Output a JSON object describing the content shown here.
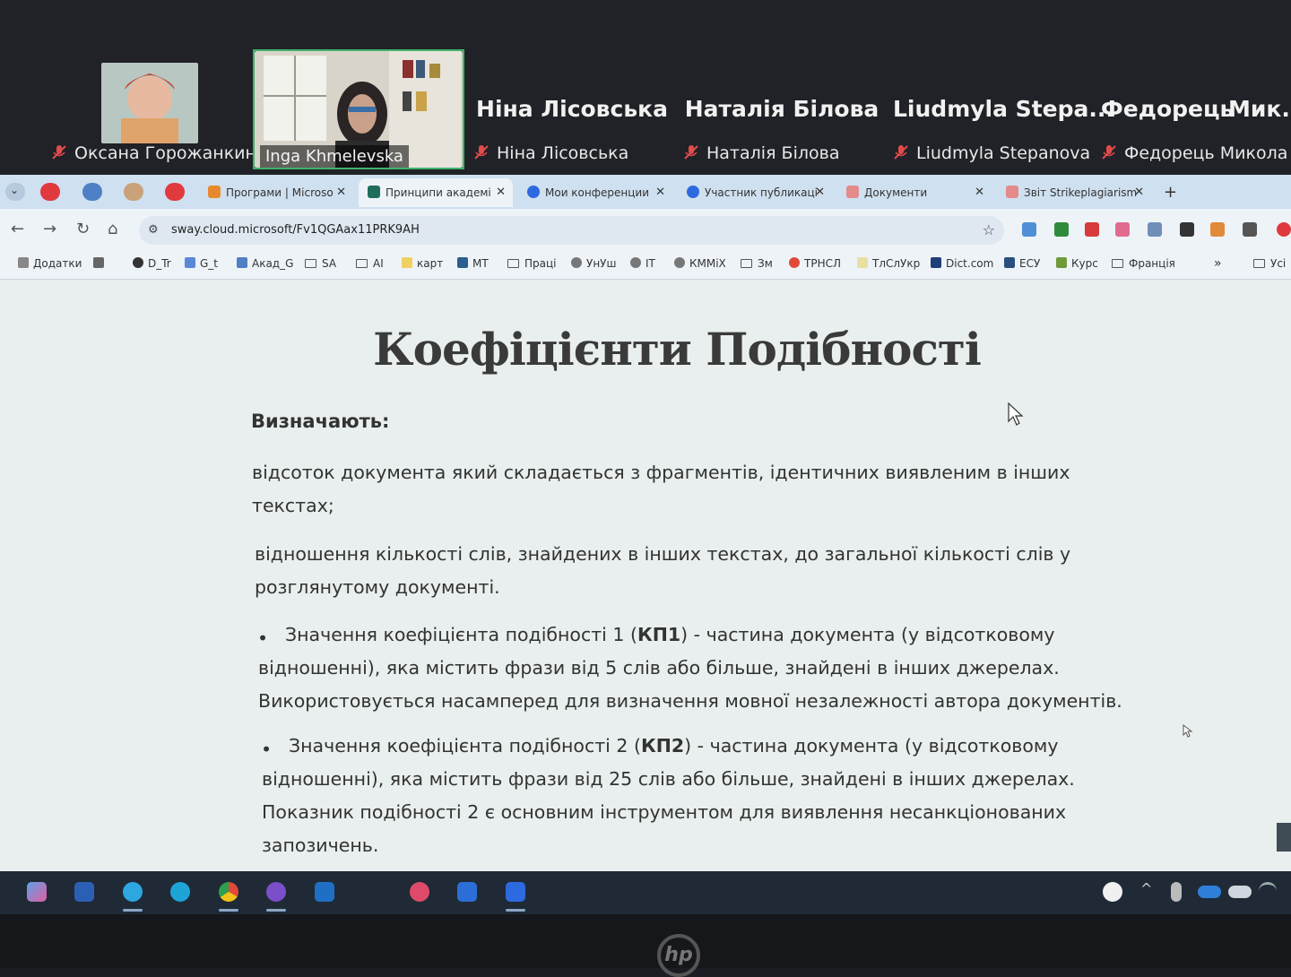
{
  "zoom": {
    "participants_video": [
      {
        "name": "Оксана Горожанкина"
      },
      {
        "name": "Inga Khmelevska"
      }
    ],
    "participants_name": [
      {
        "display": "Ніна Лісовська",
        "label": "Ніна Лісовська"
      },
      {
        "display": "Наталія Білова",
        "label": "Наталія Білова"
      },
      {
        "display": "Liudmyla  Stepa...",
        "label": "Liudmyla Stepanova"
      },
      {
        "display": "Федорець",
        "label": "Федорець Микола"
      },
      {
        "display": "Мик..",
        "label": ""
      }
    ]
  },
  "browser": {
    "tabs": [
      {
        "label": "Програми | Microso"
      },
      {
        "label": "Принципи академі"
      },
      {
        "label": "Мои конференции"
      },
      {
        "label": "Участник публикаці"
      },
      {
        "label": "Документи"
      },
      {
        "label": "Звіт Strikeplagiarism"
      }
    ],
    "url": "sway.cloud.microsoft/Fv1QGAax11PRK9AH",
    "bookmarks": [
      "Додатки",
      "D_Tr",
      "G_t",
      "Акад_G",
      "SA",
      "AI",
      "карт",
      "МТ",
      "Праці",
      "УнУш",
      "IT",
      "КММіХ",
      "Зм",
      "ТРНСЛ",
      "ТлСлУкр",
      "Dict.com",
      "ЕСУ",
      "Курс",
      "Франція",
      "»",
      "Усі"
    ]
  },
  "content": {
    "title": "Коефіцієнти Подібності",
    "heading": "Визначають:",
    "p1_line1": "відсоток документа який складається з фрагментів, ідентичних виявленим в інших",
    "p1_line2": "текстах;",
    "p2_line1": "відношення кількості слів, знайдених в інших текстах, до загальної кількості слів у",
    "p2_line2": "розглянутому документі.",
    "b1_pre": "Значення коефіцієнта подібності 1 (",
    "b1_bold": "КП1",
    "b1_post": ") - частина документа (у відсотковому",
    "b1_line2": "відношенні), яка містить фрази від 5 слів або більше, знайдені в інших джерелах.",
    "b1_line3": "Використовується насамперед для визначення мовної незалежності автора документів.",
    "b2_pre": "Значення коефіцієнта подібності 2 (",
    "b2_bold": "КП2",
    "b2_post": ") - частина документа (у відсотковому",
    "b2_line2": "відношенні), яка містить фрази від 25 слів або більше, знайдені в інших джерелах.",
    "b2_line3": "Показник подібності 2 є основним інструментом для виявлення несанкціонованих",
    "b2_line4": "запозичень."
  },
  "colors": {
    "active_speaker": "#3fb36a",
    "tab_bar": "#cfe0f0",
    "page_bg": "#e9efee",
    "taskbar": "#1f2a36"
  }
}
